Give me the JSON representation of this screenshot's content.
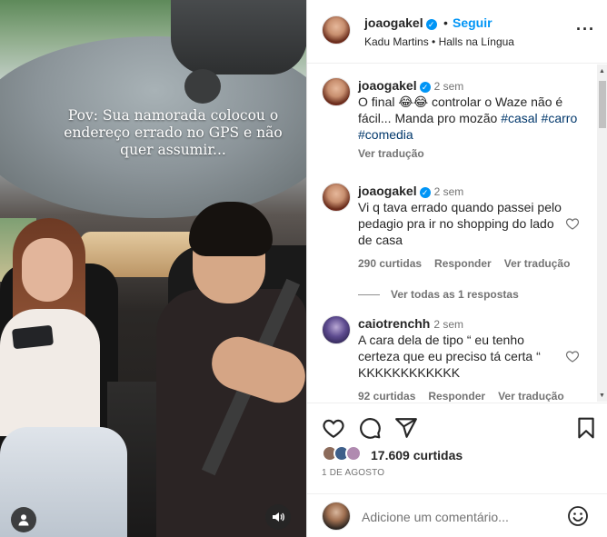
{
  "video": {
    "caption": "Pov: Sua namorada colocou o endereço errado no GPS e não quer assumir..."
  },
  "header": {
    "username": "joaogakel",
    "separator": "•",
    "follow_label": "Seguir",
    "subtitle": "Kadu Martins • Halls na Língua"
  },
  "caption_post": {
    "username": "joaogakel",
    "time": "2 sem",
    "text": "O final 😂😂 controlar o Waze não é fácil... Manda pro mozão ",
    "tags": [
      "#casal",
      "#carro",
      "#comedia"
    ],
    "translate": "Ver tradução"
  },
  "comments": [
    {
      "username": "joaogakel",
      "time": "2 sem",
      "text": "Vi q tava errado quando passei pelo pedagio pra ir no shopping do lado de casa",
      "likes": "290 curtidas",
      "reply": "Responder",
      "translate": "Ver tradução",
      "view_replies": "Ver todas as 1 respostas"
    },
    {
      "username": "caiotrenchh",
      "time": "2 sem",
      "text": "A cara dela de tipo “ eu tenho certeza que eu preciso tá certa “ KKKKKKKKKKKK",
      "likes": "92 curtidas",
      "reply": "Responder",
      "translate": "Ver tradução"
    }
  ],
  "actions": {
    "likes": "17.609 curtidas",
    "date": "1 DE AGOSTO"
  },
  "composer": {
    "placeholder": "Adicione um comentário..."
  },
  "colors": {
    "accent": "#0095f6",
    "hashtag": "#00376b",
    "muted": "#737373",
    "text": "#262626"
  }
}
